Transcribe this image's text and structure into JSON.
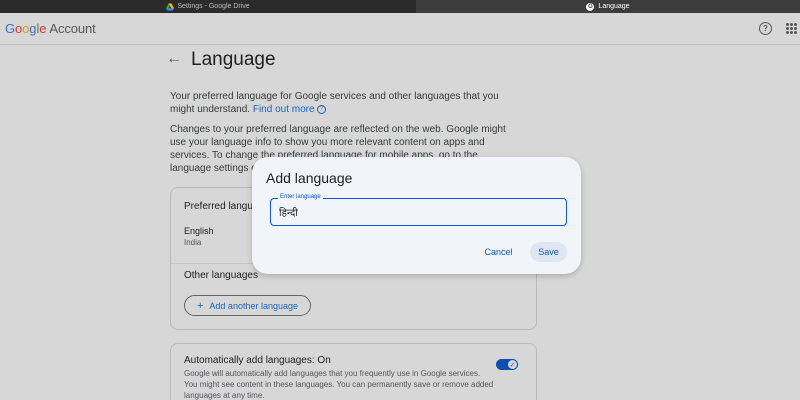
{
  "browser": {
    "tabs": [
      {
        "title": "Settings - Google Drive",
        "icon": "drive-icon",
        "active": false
      },
      {
        "title": "Language",
        "icon": "google-icon",
        "active": true
      }
    ]
  },
  "header": {
    "logo_parts": [
      "G",
      "o",
      "o",
      "g",
      "l",
      "e"
    ],
    "account_label": "Account",
    "help_glyph": "?"
  },
  "page": {
    "title": "Language",
    "back_glyph": "←",
    "intro_text": "Your preferred language for Google services and other languages that you might understand.",
    "find_out_more": "Find out more",
    "changes_text": "Changes to your preferred language are reflected on the web. Google might use your language info to show you more relevant content on apps and services. To change the preferred language for mobile apps, go to the language settings on y",
    "preferred_heading": "Preferred langu",
    "preferred_language": {
      "name": "English",
      "region": "India"
    },
    "other_heading": "Other languages",
    "add_another_label": "Add another language",
    "auto_heading": "Automatically add languages: On",
    "auto_description": "Google will automatically add languages that you frequently use in Google services. You might see content in these languages. You can permanently save or remove added languages at any time.",
    "auto_toggle_on": true
  },
  "dialog": {
    "title": "Add language",
    "input_label": "Enter language",
    "input_value": "हिन्दी",
    "cancel_label": "Cancel",
    "save_label": "Save"
  },
  "colors": {
    "accent": "#0b57d0",
    "link": "#1a73e8",
    "dialog_bg": "#f1f4f8"
  }
}
